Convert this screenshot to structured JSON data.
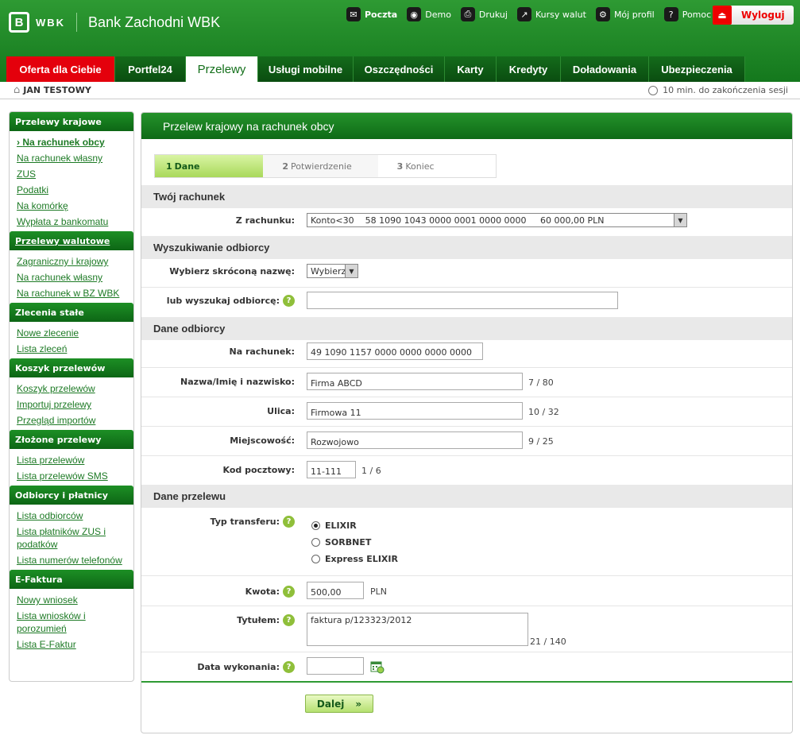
{
  "header": {
    "logo_mark": "B",
    "logo_word": "WBK",
    "bank_name": "Bank Zachodni WBK"
  },
  "toplinks": [
    {
      "label": "Poczta",
      "icon": "mail-icon",
      "glyph": "✉"
    },
    {
      "label": "Demo",
      "icon": "demo-icon",
      "glyph": "◉"
    },
    {
      "label": "Drukuj",
      "icon": "print-icon",
      "glyph": "⎙"
    },
    {
      "label": "Kursy walut",
      "icon": "chart-icon",
      "glyph": "↗"
    },
    {
      "label": "Mój profil",
      "icon": "profile-icon",
      "glyph": "⚙"
    },
    {
      "label": "Pomoc",
      "icon": "help-icon",
      "glyph": "?"
    }
  ],
  "logout": {
    "label": "Wyloguj",
    "glyph": "⏏"
  },
  "tabs": [
    {
      "label": "Oferta dla Ciebie"
    },
    {
      "label": "Portfel24"
    },
    {
      "label": "Przelewy"
    },
    {
      "label": "Usługi mobilne"
    },
    {
      "label": "Oszczędności"
    },
    {
      "label": "Karty"
    },
    {
      "label": "Kredyty"
    },
    {
      "label": "Doładowania"
    },
    {
      "label": "Ubezpieczenia"
    }
  ],
  "user": {
    "name": "JAN TESTOWY",
    "session": "10 min. do zakończenia sesji"
  },
  "sidebar": {
    "sections": [
      {
        "title": "Przelewy krajowe",
        "items": [
          "Na rachunek obcy",
          "Na rachunek własny",
          "ZUS",
          "Podatki",
          "Na komórkę",
          "Wypłata z bankomatu"
        ]
      },
      {
        "title": "Przelewy walutowe",
        "items": [
          "Zagraniczny i krajowy",
          "Na rachunek własny",
          "Na rachunek w BZ WBK"
        ]
      },
      {
        "title": "Zlecenia stałe",
        "items": [
          "Nowe zlecenie",
          "Lista zleceń"
        ]
      },
      {
        "title": "Koszyk przelewów",
        "items": [
          "Koszyk przelewów",
          "Importuj przelewy",
          "Przegląd importów"
        ]
      },
      {
        "title": "Złożone przelewy",
        "items": [
          "Lista przelewów",
          "Lista przelewów SMS"
        ]
      },
      {
        "title": "Odbiorcy i płatnicy",
        "items": [
          "Lista odbiorców",
          "Lista płatników ZUS i podatków",
          "Lista numerów telefonów"
        ]
      },
      {
        "title": "E-Faktura",
        "items": [
          "Nowy wniosek",
          "Lista wniosków i porozumień",
          "Lista E-Faktur"
        ]
      }
    ]
  },
  "main": {
    "title": "Przelew krajowy na rachunek obcy",
    "steps": [
      {
        "num": "1",
        "label": "Dane"
      },
      {
        "num": "2",
        "label": "Potwierdzenie"
      },
      {
        "num": "3",
        "label": "Koniec"
      }
    ],
    "sections": {
      "account": "Twój rachunek",
      "search": "Wyszukiwanie odbiorcy",
      "recipient": "Dane odbiorcy",
      "transfer": "Dane przelewu"
    },
    "from_account": {
      "label": "Z rachunku:",
      "value": "Konto<30    58 1090 1043 0000 0001 0000 0000     60 000,00 PLN"
    },
    "short_name": {
      "label": "Wybierz skróconą nazwę:",
      "value": "Wybierz"
    },
    "search_recipient": {
      "label": "lub wyszukaj odbiorcę:",
      "value": ""
    },
    "to_account": {
      "label": "Na rachunek:",
      "value": "49 1090 1157 0000 0000 0000 0000"
    },
    "name": {
      "label": "Nazwa/Imię i nazwisko:",
      "value": "Firma ABCD",
      "counter": "7 / 80"
    },
    "street": {
      "label": "Ulica:",
      "value": "Firmowa 11",
      "counter": "10 / 32"
    },
    "city": {
      "label": "Miejscowość:",
      "value": "Rozwojowo",
      "counter": "9 / 25"
    },
    "postal": {
      "label": "Kod pocztowy:",
      "value": "11-111",
      "counter": "1 / 6"
    },
    "transfer_type": {
      "label": "Typ transferu:",
      "options": [
        "ELIXIR",
        "SORBNET",
        "Express ELIXIR"
      ],
      "selected": "ELIXIR"
    },
    "amount": {
      "label": "Kwota:",
      "value": "500,00",
      "currency": "PLN"
    },
    "title_field": {
      "label": "Tytułem:",
      "value": "faktura p/123323/2012",
      "counter": "21 / 140"
    },
    "date": {
      "label": "Data wykonania:",
      "value": ""
    },
    "next_button": "Dalej"
  },
  "colors": {
    "brand_green": "#14781d",
    "accent_red": "#e4000c",
    "link_green": "#1d7a25"
  }
}
